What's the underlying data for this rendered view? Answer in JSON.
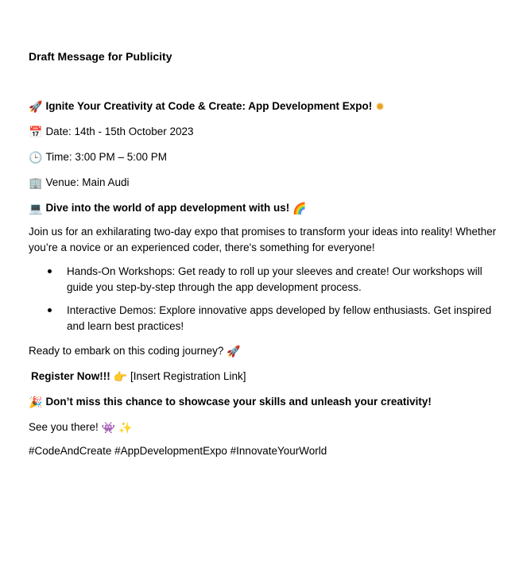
{
  "document": {
    "heading": "Draft Message for Publicity",
    "headline": {
      "icon": "rocket-icon",
      "icon_glyph": "🚀",
      "text": "Ignite Your Creativity at Code & Create: App Development Expo!",
      "trail_icon": "sparkle-sun-icon",
      "trail_glyph": "✹"
    },
    "date": {
      "icon": "calendar-icon",
      "icon_glyph": "📅",
      "text": "Date: 14th - 15th October 2023"
    },
    "time": {
      "icon": "clock-icon",
      "icon_glyph": "🕒",
      "text": "Time: 3:00 PM – 5:00 PM"
    },
    "venue": {
      "icon": "building-icon",
      "icon_glyph": "🏢",
      "text": "Venue: Main Audi"
    },
    "dive": {
      "icon": "laptop-icon",
      "icon_glyph": "💻",
      "text": "Dive into the world of app development with us!",
      "trail_icon": "rainbow-icon",
      "trail_glyph": "🌈"
    },
    "intro": "Join us for an exhilarating two-day expo that promises to transform your ideas into reality! Whether you’re a novice or an experienced coder, there's something for everyone!",
    "bullets": [
      "Hands-On Workshops: Get ready to roll up your sleeves and create! Our workshops will guide you step-by-step through the app development process.",
      "Interactive Demos: Explore innovative apps developed by fellow enthusiasts. Get inspired and learn best practices!"
    ],
    "journey": {
      "text": "Ready to embark on this coding journey?",
      "trail_icon": "rocket-icon",
      "trail_glyph": "🚀"
    },
    "register": {
      "bold_text": "Register Now!!!",
      "icon": "pointing-hand-icon",
      "icon_glyph": "👉",
      "link_text": "[Insert Registration Link]"
    },
    "dont_miss": {
      "icon": "party-popper-icon",
      "icon_glyph": "🎉",
      "text": "Don’t miss this chance to showcase your skills and unleash your creativity!"
    },
    "see_you": {
      "text": "See you there!",
      "icon1": "alien-monster-icon",
      "icon1_glyph": "👾",
      "icon2": "sparkles-icon",
      "icon2_glyph": "✨"
    },
    "hashtags": "#CodeAndCreate #AppDevelopmentExpo #InnovateYourWorld"
  }
}
